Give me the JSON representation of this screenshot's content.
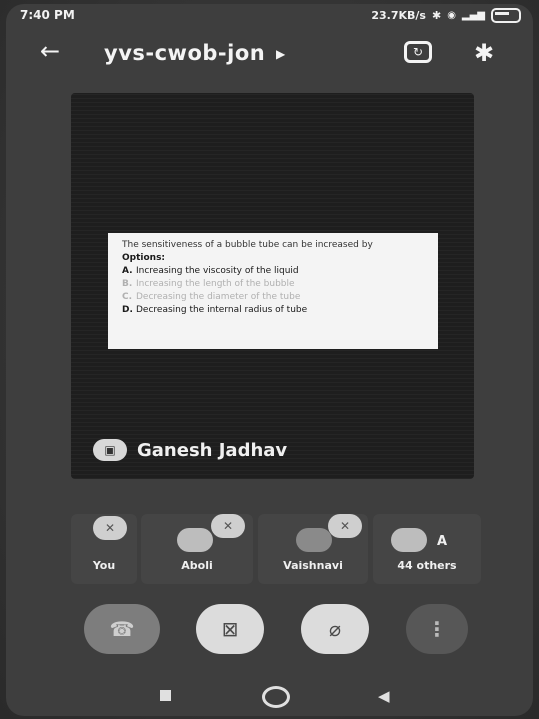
{
  "status_bar": {
    "time": "7:40 PM",
    "net_speed": "23.7KB/s",
    "icons": [
      "bluetooth-icon",
      "wifi-icon",
      "volte-icon",
      "signal-icon",
      "battery-icon"
    ]
  },
  "header": {
    "meeting_code": "yvs-cwob-jon",
    "icons": [
      "back-arrow-icon",
      "chevron-right-icon",
      "camera-switch-icon",
      "bluetooth-audio-icon"
    ]
  },
  "presentation": {
    "question": "The sensitiveness of a bubble tube can be increased by",
    "options_label": "Options:",
    "options": [
      {
        "key": "A.",
        "text": "Increasing the viscosity of the liquid"
      },
      {
        "key": "B.",
        "text": "Increasing the length of the bubble"
      },
      {
        "key": "C.",
        "text": "Decreasing the diameter of the tube"
      },
      {
        "key": "D.",
        "text": "Decreasing the internal radius of tube"
      }
    ],
    "presenter_name": "Ganesh Jadhav"
  },
  "participants": [
    {
      "label": "You"
    },
    {
      "label": "Aboli"
    },
    {
      "label": "Vaishnavi"
    },
    {
      "label": "44 others",
      "initial": "A"
    }
  ],
  "controls": {
    "icons": [
      "end-call-icon",
      "camera-off-icon",
      "mic-off-icon",
      "more-options-icon"
    ]
  },
  "colors": {
    "background": "#3a3a3a",
    "tile": "#454545",
    "control_light": "#dcdcdc",
    "slide_bg": "#f4f4f4"
  }
}
